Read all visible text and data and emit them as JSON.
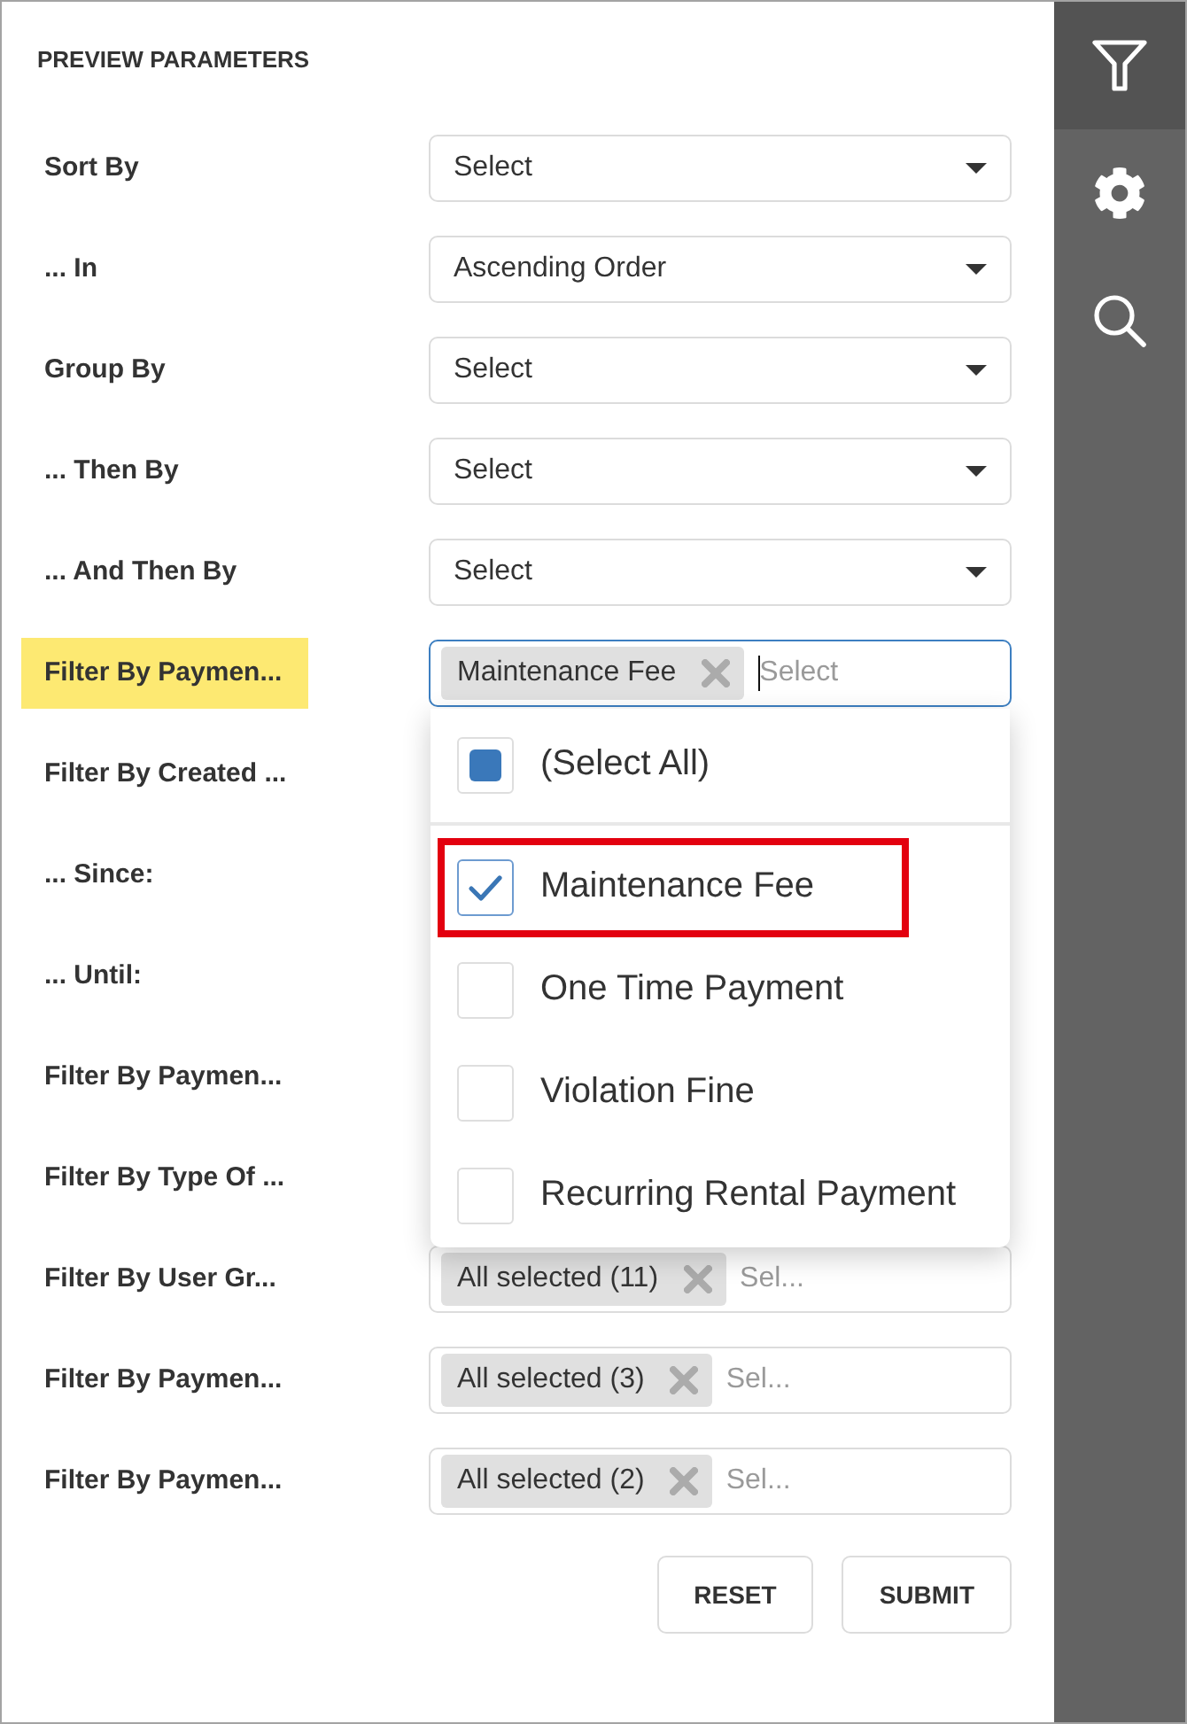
{
  "panel": {
    "title": "PREVIEW PARAMETERS"
  },
  "parameters": [
    {
      "label": "Sort By",
      "highlighted": false,
      "field": {
        "kind": "select",
        "value": "Select"
      }
    },
    {
      "label": "... In",
      "highlighted": false,
      "field": {
        "kind": "select",
        "value": "Ascending Order"
      }
    },
    {
      "label": "Group By",
      "highlighted": false,
      "field": {
        "kind": "select",
        "value": "Select"
      }
    },
    {
      "label": "... Then By",
      "highlighted": false,
      "field": {
        "kind": "select",
        "value": "Select"
      }
    },
    {
      "label": "... And Then By",
      "highlighted": false,
      "field": {
        "kind": "select",
        "value": "Select"
      }
    },
    {
      "label": "Filter By Paymen...",
      "highlighted": true,
      "field": {
        "kind": "multi",
        "tags": [
          "Maintenance Fee"
        ],
        "placeholder": "Select",
        "focused": true,
        "dropdown": {
          "select_all": {
            "label": "(Select All)",
            "indeterminate": true
          },
          "options": [
            {
              "label": "Maintenance Fee",
              "checked": true,
              "highlighted": true
            },
            {
              "label": "One Time Payment",
              "checked": false,
              "highlighted": false
            },
            {
              "label": "Violation Fine",
              "checked": false,
              "highlighted": false
            },
            {
              "label": "Recurring Rental Payment",
              "checked": false,
              "highlighted": false
            }
          ]
        }
      }
    },
    {
      "label": "Filter By Created ...",
      "highlighted": false
    },
    {
      "label": "... Since:",
      "highlighted": false
    },
    {
      "label": "... Until:",
      "highlighted": false
    },
    {
      "label": "Filter By Paymen...",
      "highlighted": false
    },
    {
      "label": "Filter By Type Of ...",
      "highlighted": false
    },
    {
      "label": "Filter By User Gr...",
      "highlighted": false,
      "field": {
        "kind": "multi",
        "tags": [
          "All selected (11)"
        ],
        "placeholder": "Sel...",
        "focused": false
      }
    },
    {
      "label": "Filter By Paymen...",
      "highlighted": false,
      "field": {
        "kind": "multi",
        "tags": [
          "All selected (3)"
        ],
        "placeholder": "Sel...",
        "focused": false
      }
    },
    {
      "label": "Filter By Paymen...",
      "highlighted": false,
      "field": {
        "kind": "multi",
        "tags": [
          "All selected (2)"
        ],
        "placeholder": "Sel...",
        "focused": false
      }
    }
  ],
  "buttons": [
    "RESET",
    "SUBMIT"
  ],
  "sidebar": {
    "items": [
      {
        "kind": "filter",
        "selected": true
      },
      {
        "kind": "settings",
        "selected": false
      },
      {
        "kind": "search",
        "selected": false
      }
    ]
  }
}
